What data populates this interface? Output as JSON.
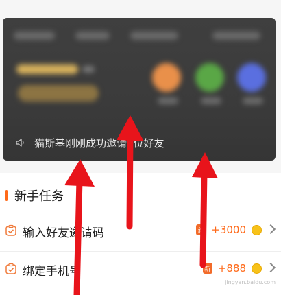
{
  "invite_card": {
    "notice_text": "猫斯基刚刚成功邀请1位好友",
    "colors": {
      "card_bg": "#3b3b3b",
      "notice_text": "#e8e8e8"
    }
  },
  "new_user_tasks": {
    "title": "新手任务",
    "items": [
      {
        "label": "输入好友邀请码",
        "tag": "新",
        "reward": "+3000",
        "icon": "checklist-icon"
      },
      {
        "label": "绑定手机号",
        "tag": "新",
        "reward": "+888",
        "icon": "checklist-icon"
      }
    ]
  },
  "watermark": "jingyan.baidu.com",
  "colors": {
    "accent": "#ff6a1a",
    "arrow": "#e8141b",
    "coin": "#f7c21a"
  }
}
